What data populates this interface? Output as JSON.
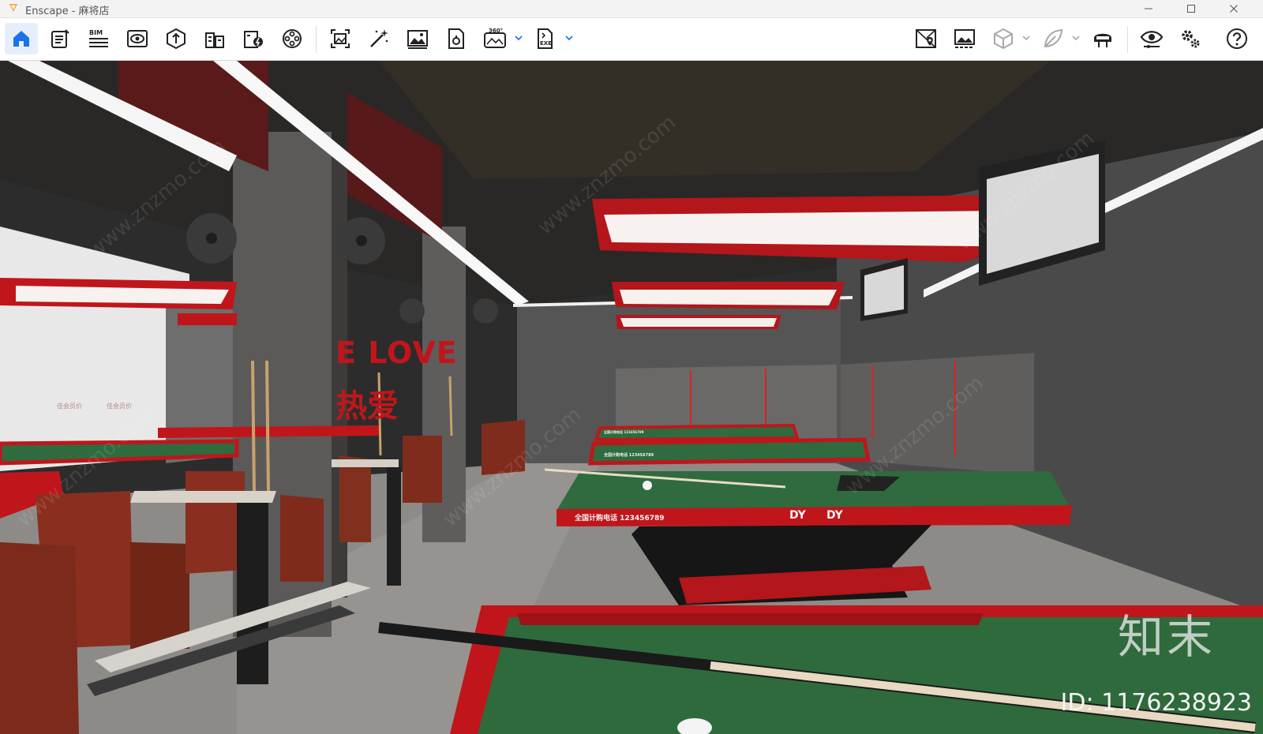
{
  "window": {
    "app_name": "Enscape",
    "title": "Enscape - 麻将店",
    "controls": [
      "minimize-icon",
      "maximize-icon",
      "close-icon"
    ]
  },
  "toolbar": {
    "left": [
      {
        "icon": "home-icon",
        "active": true
      },
      {
        "icon": "notes-icon"
      },
      {
        "icon": "bim-icon",
        "label": "BIM"
      },
      {
        "icon": "view-icon"
      },
      {
        "icon": "asset-library-icon"
      },
      {
        "icon": "buildings-icon"
      },
      {
        "icon": "lightning-icon"
      },
      {
        "icon": "video-reel-icon"
      },
      {
        "icon": "screenshot-icon"
      },
      {
        "icon": "magic-wand-icon"
      },
      {
        "icon": "image-icon"
      },
      {
        "icon": "export-file-icon"
      },
      {
        "icon": "panorama-icon",
        "label": "360°",
        "dropdown": true
      },
      {
        "icon": "exe-export-icon",
        "label": "EXE",
        "dropdown": true
      }
    ],
    "right": [
      {
        "icon": "map-pin-icon"
      },
      {
        "icon": "gallery-icon"
      },
      {
        "icon": "cube-icon",
        "dropdown": true
      },
      {
        "icon": "leaf-icon",
        "dropdown": true
      },
      {
        "icon": "vr-headset-icon"
      },
      {
        "icon": "eye-settings-icon"
      },
      {
        "icon": "gears-icon"
      },
      {
        "icon": "help-icon"
      }
    ],
    "collapse_icon": "chevron-up-icon"
  },
  "scene": {
    "sign_love": "E LOVE",
    "sign_cn": "热爱",
    "table_phone_1": "全国计购电话  123456789",
    "table_phone_2": "全国计购电话  123456789",
    "table_phone_3": "全国计购电话  123456789",
    "table_logo": "DY",
    "window_sticker_1": "佳会员价",
    "window_sticker_2": "佳会员价",
    "watermark_diag": "www.znzmo.com",
    "watermark_brand": "知末",
    "watermark_id": "ID: 1176238923"
  },
  "colors": {
    "accent_red": "#c0161b",
    "felt_green": "#2f6b3e",
    "wall_grey": "#4a4a4a",
    "home_blue": "#1a73e8",
    "logo_orange": "#f2a23a"
  }
}
